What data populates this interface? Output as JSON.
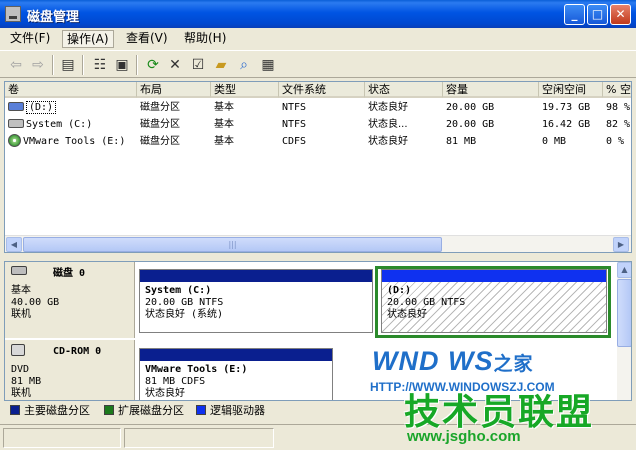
{
  "window": {
    "title": "磁盘管理",
    "buttons": {
      "minimize": "_",
      "maximize": "□",
      "close": "✕"
    }
  },
  "menu": [
    {
      "label": "文件(F)"
    },
    {
      "label": "操作(A)"
    },
    {
      "label": "查看(V)"
    },
    {
      "label": "帮助(H)"
    }
  ],
  "toolbar": {
    "icons": [
      "back-icon",
      "forward-icon",
      "up-level-icon",
      "properties-icon",
      "help-icon",
      "show-hide-tree-icon",
      "refresh-icon",
      "delete-icon",
      "console-properties-icon",
      "open-icon",
      "search-icon",
      "export-icon"
    ]
  },
  "volumes": {
    "columns": [
      "卷",
      "布局",
      "类型",
      "文件系统",
      "状态",
      "容量",
      "空闲空间",
      "% 空"
    ],
    "rows": [
      {
        "volume": "(D:)",
        "layout": "磁盘分区",
        "type": "基本",
        "fs": "NTFS",
        "status": "状态良好",
        "capacity": "20.00 GB",
        "free": "19.73 GB",
        "pct": "98 %"
      },
      {
        "volume": "System (C:)",
        "layout": "磁盘分区",
        "type": "基本",
        "fs": "NTFS",
        "status": "状态良...",
        "capacity": "20.00 GB",
        "free": "16.42 GB",
        "pct": "82 %"
      },
      {
        "volume": "VMware Tools (E:)",
        "layout": "磁盘分区",
        "type": "基本",
        "fs": "CDFS",
        "status": "状态良好",
        "capacity": "81 MB",
        "free": "0 MB",
        "pct": "0 %"
      }
    ]
  },
  "disks": [
    {
      "name": "磁盘 0",
      "kind": "基本",
      "size": "40.00 GB",
      "state": "联机",
      "partitions": [
        {
          "name": "System  (C:)",
          "detail": "20.00 GB NTFS",
          "status": "状态良好 (系统)"
        },
        {
          "name": "(D:)",
          "detail": "20.00 GB NTFS",
          "status": "状态良好"
        }
      ]
    },
    {
      "name": "CD-ROM 0",
      "kind": "DVD",
      "size": "81 MB",
      "state": "联机",
      "partitions": [
        {
          "name": "VMware Tools  (E:)",
          "detail": "81 MB CDFS",
          "status": "状态良好"
        }
      ]
    }
  ],
  "legend": [
    {
      "label": "主要磁盘分区",
      "color": "#0a1f8f"
    },
    {
      "label": "扩展磁盘分区",
      "color": "#1c7a1c"
    },
    {
      "label": "逻辑驱动器",
      "color": "#0f31f0"
    }
  ],
  "watermark": {
    "logo": "WND WS",
    "logo_zh": "之家",
    "url_top": "HTTP://WWW.WINDOWSZJ.COM",
    "big": "技术员联盟",
    "url": "www.jsgho.com"
  }
}
